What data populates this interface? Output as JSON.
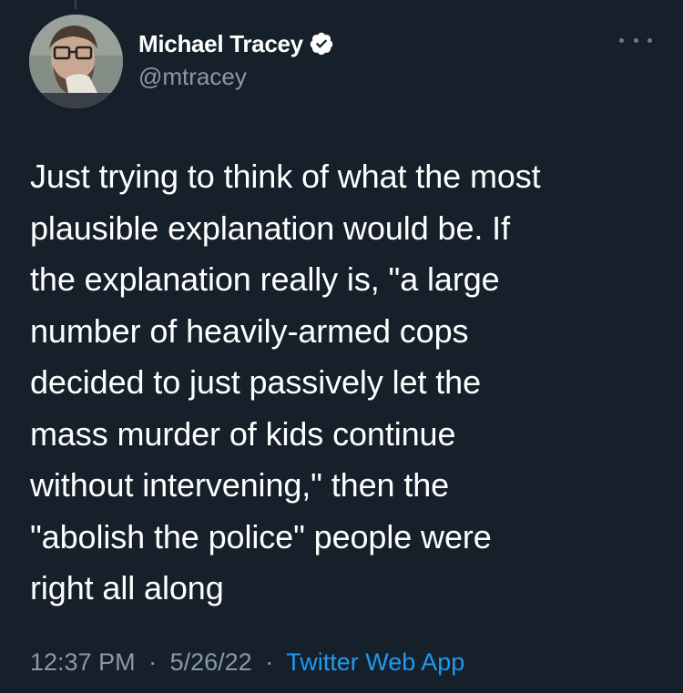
{
  "author": {
    "display_name": "Michael Tracey",
    "handle": "@mtracey",
    "verified": true,
    "avatar_icon": "avatar-photo"
  },
  "tweet": {
    "text": "Just trying to think of what the most\nplausible explanation would be. If\nthe explanation really is, \"a large\nnumber of heavily-armed cops\ndecided to just passively let the\nmass murder of kids continue\nwithout intervening,\" then the\n\"abolish the police\" people were\nright all along",
    "time": "12:37 PM",
    "separator": "·",
    "date": "5/26/22",
    "source": "Twitter Web App"
  },
  "colors": {
    "background": "#15202b",
    "text": "#ffffff",
    "secondary": "#8b98a5",
    "accent": "#1d9bf0"
  },
  "icons": {
    "verified": "verified-badge-icon",
    "more": "more-options-icon"
  }
}
